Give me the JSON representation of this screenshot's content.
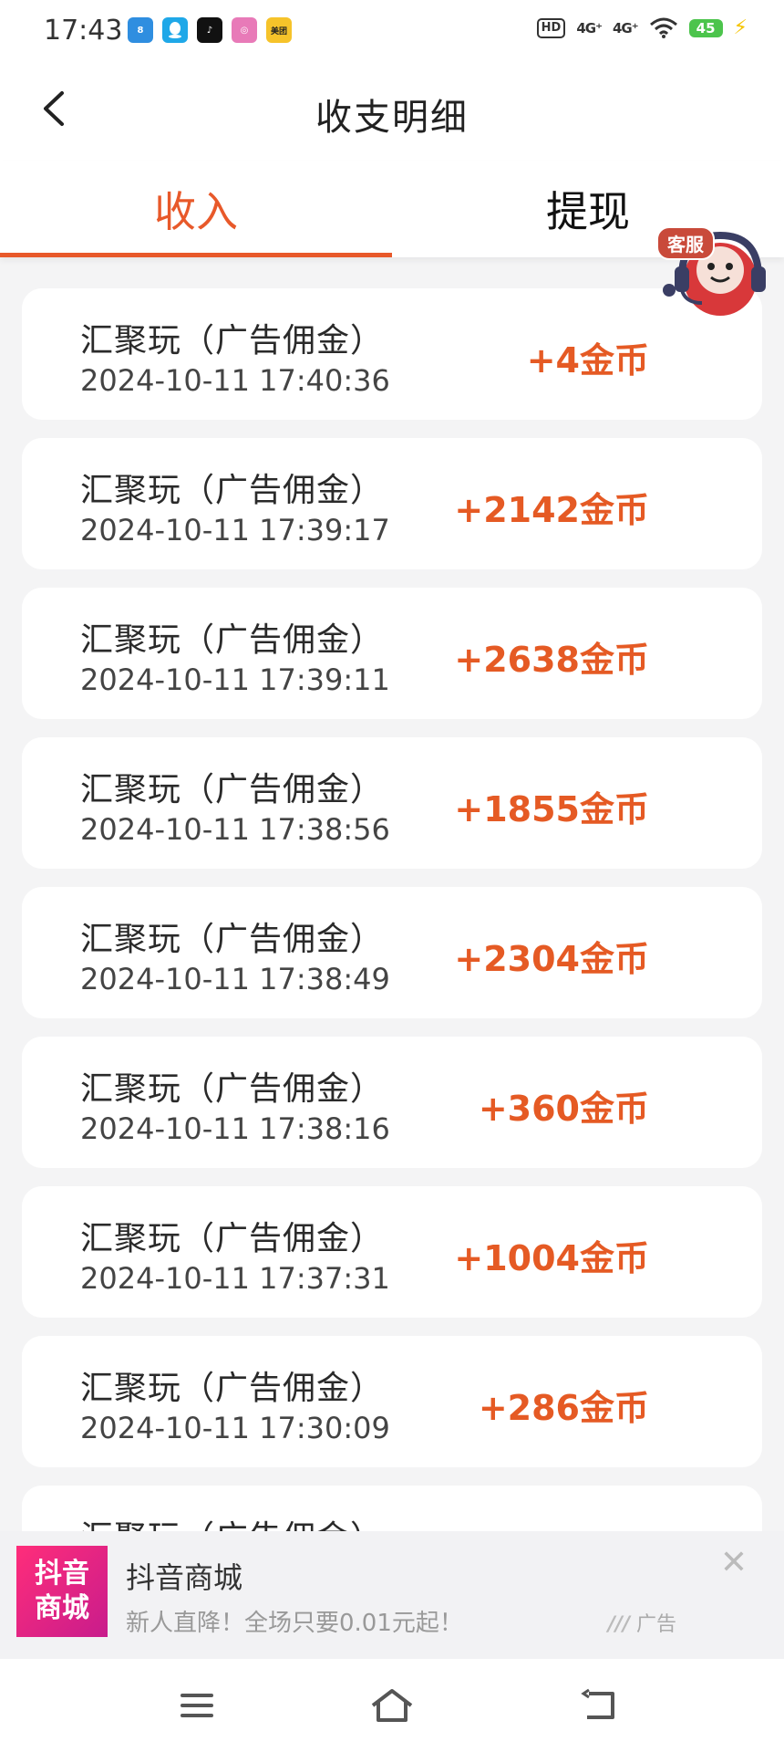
{
  "status_bar": {
    "time": "17:43",
    "hd": "HD",
    "signal1": "4G⁺",
    "signal2": "4G⁺",
    "battery": "45",
    "apps": [
      {
        "name": "wifi-app",
        "color": "#2f8ee0",
        "label": "8"
      },
      {
        "name": "qq",
        "color": "#1fa8e8",
        "label": ""
      },
      {
        "name": "tiktok",
        "color": "#111111",
        "label": "♪"
      },
      {
        "name": "instagram-like",
        "color": "#e87ab8",
        "label": "◎"
      },
      {
        "name": "meituan",
        "color": "#f6c32a",
        "label": "美团"
      }
    ]
  },
  "header": {
    "title": "收支明细"
  },
  "tabs": [
    {
      "label": "收入",
      "active": true
    },
    {
      "label": "提现",
      "active": false
    }
  ],
  "service": {
    "badge": "客服"
  },
  "records": [
    {
      "title": "汇聚玩（广告佣金）",
      "time": "2024-10-11 17:40:36",
      "amount": "+4金币"
    },
    {
      "title": "汇聚玩（广告佣金）",
      "time": "2024-10-11 17:39:17",
      "amount": "+2142金币"
    },
    {
      "title": "汇聚玩（广告佣金）",
      "time": "2024-10-11 17:39:11",
      "amount": "+2638金币"
    },
    {
      "title": "汇聚玩（广告佣金）",
      "time": "2024-10-11 17:38:56",
      "amount": "+1855金币"
    },
    {
      "title": "汇聚玩（广告佣金）",
      "time": "2024-10-11 17:38:49",
      "amount": "+2304金币"
    },
    {
      "title": "汇聚玩（广告佣金）",
      "time": "2024-10-11 17:38:16",
      "amount": "+360金币"
    },
    {
      "title": "汇聚玩（广告佣金）",
      "time": "2024-10-11 17:37:31",
      "amount": "+1004金币"
    },
    {
      "title": "汇聚玩（广告佣金）",
      "time": "2024-10-11 17:30:09",
      "amount": "+286金币"
    },
    {
      "title": "汇聚玩（广告佣金）",
      "time": "",
      "amount": ""
    }
  ],
  "ad": {
    "logo_line1": "抖音",
    "logo_line2": "商城",
    "title": "抖音商城",
    "subtitle": "新人直降！全场只要0.01元起！",
    "tag": "广告",
    "close": "✕"
  },
  "colors": {
    "accent": "#e8592a",
    "amount": "#e55a24"
  }
}
